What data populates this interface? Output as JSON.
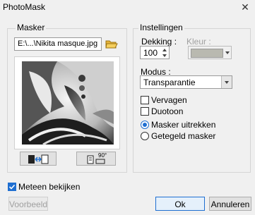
{
  "window": {
    "title": "PhotoMask",
    "close_glyph": "✕"
  },
  "mask_panel": {
    "title": "Masker",
    "file_path": "E:\\...\\Nikita masque.jpg",
    "buttons": [
      {
        "name": "flip-mask-button",
        "icon": "swap-arrows-icon"
      },
      {
        "name": "rotate-mask-button",
        "icon": "rotate-90-icon",
        "badge": "90°"
      }
    ]
  },
  "settings_panel": {
    "title": "Instellingen",
    "opacity_label": "Dekking :",
    "opacity_value": "100",
    "color_label": "Kleur :",
    "color_value": "#b9b9b0",
    "mode_label": "Modus :",
    "mode_value": "Transparantie",
    "options": {
      "blur": {
        "label": "Vervagen",
        "checked": false
      },
      "duotone": {
        "label": "Duotoon",
        "checked": false
      }
    },
    "radios": {
      "subtract": {
        "label": "Masker uitrekken",
        "selected": true
      },
      "tile": {
        "label": "Getegeld masker",
        "selected": false
      }
    }
  },
  "footer": {
    "preview_checkbox": {
      "label": "Meteen bekijken",
      "checked": true
    },
    "preview_button": "Voorbeeld",
    "ok_button": "Ok",
    "cancel_button": "Annuleren"
  },
  "colors": {
    "accent": "#1f6fd1",
    "disabled_text": "#a0a0a0"
  }
}
